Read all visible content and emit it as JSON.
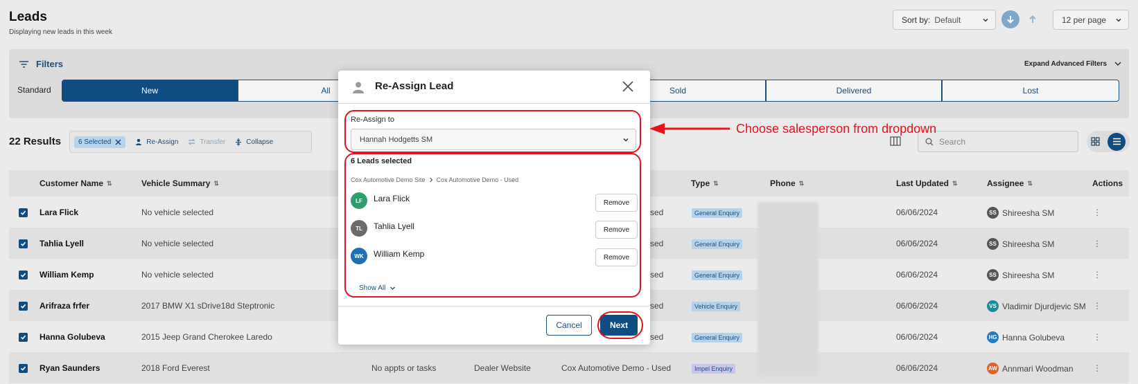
{
  "header": {
    "title": "Leads",
    "subtitle": "Displaying new leads in this week",
    "sort_label": "Sort by:",
    "sort_value": "Default",
    "per_page": "12 per page"
  },
  "filters": {
    "title": "Filters",
    "expand_label": "Expand Advanced Filters",
    "standard_label": "Standard",
    "segments": [
      "New",
      "All",
      "Sold",
      "Delivered",
      "Lost"
    ],
    "active_segment": "New"
  },
  "results": {
    "count_label": "22 Results",
    "selected_chip": "6 Selected",
    "actions": {
      "reassign": "Re-Assign",
      "transfer": "Transfer",
      "collapse": "Collapse"
    },
    "search_placeholder": "Search"
  },
  "table": {
    "columns": {
      "customer": "Customer Name",
      "vehicle": "Vehicle Summary",
      "type": "Type",
      "phone": "Phone",
      "updated": "Last Updated",
      "assignee": "Assignee",
      "actions": "Actions"
    },
    "rows": [
      {
        "name": "Lara Flick",
        "vehicle": "No vehicle selected",
        "site": "sed",
        "type": "General Enquiry",
        "updated": "06/06/2024",
        "assignee": "Shireesha SM",
        "initials": "SS",
        "avatar_color": "#555555"
      },
      {
        "name": "Tahlia Lyell",
        "vehicle": "No vehicle selected",
        "site": "sed",
        "type": "General Enquiry",
        "updated": "06/06/2024",
        "assignee": "Shireesha SM",
        "initials": "SS",
        "avatar_color": "#555555"
      },
      {
        "name": "William Kemp",
        "vehicle": "No vehicle selected",
        "site": "sed",
        "type": "General Enquiry",
        "updated": "06/06/2024",
        "assignee": "Shireesha SM",
        "initials": "SS",
        "avatar_color": "#555555"
      },
      {
        "name": "Arifraza frfer",
        "vehicle": "2017 BMW X1 sDrive18d Steptronic",
        "site": "sed",
        "type": "Vehicle Enquiry",
        "updated": "06/06/2024",
        "assignee": "Vladimir Djurdjevic SM",
        "initials": "VS",
        "avatar_color": "#1a8a9c"
      },
      {
        "name": "Hanna Golubeva",
        "vehicle": "2015 Jeep Grand Cherokee Laredo",
        "site": "sed",
        "type": "General Enquiry",
        "updated": "06/06/2024",
        "assignee": "Hanna Golubeva",
        "initials": "HG",
        "avatar_color": "#2a7bc4"
      },
      {
        "name": "Ryan Saunders",
        "vehicle": "2018 Ford Everest",
        "appts": "No appts or tasks",
        "source": "Dealer Website",
        "site": "Cox Automotive Demo - Used",
        "type": "Impel Enquiry",
        "updated": "06/06/2024",
        "assignee": "Annmari Woodman",
        "initials": "AW",
        "avatar_color": "#e0622a"
      }
    ]
  },
  "modal": {
    "title": "Re-Assign Lead",
    "reassign_label": "Re-Assign to",
    "selected_assignee": "Hannah Hodgetts SM",
    "leads_selected": "6 Leads selected",
    "crumb_site": "Cox Automotive Demo Site",
    "crumb_dept": "Cox Automotive Demo - Used",
    "leads": [
      {
        "name": "Lara Flick",
        "initials": "LF",
        "color": "#2e9e6b"
      },
      {
        "name": "Tahlia Lyell",
        "initials": "TL",
        "color": "#6b6b6b"
      },
      {
        "name": "William Kemp",
        "initials": "WK",
        "color": "#1f6fb5"
      }
    ],
    "remove_label": "Remove",
    "show_all": "Show All",
    "cancel": "Cancel",
    "next": "Next"
  },
  "annotation": {
    "text": "Choose salesperson from dropdown",
    "color": "#e3141a"
  },
  "colors": {
    "brand": "#0f4c81",
    "annotation": "#e3141a"
  }
}
